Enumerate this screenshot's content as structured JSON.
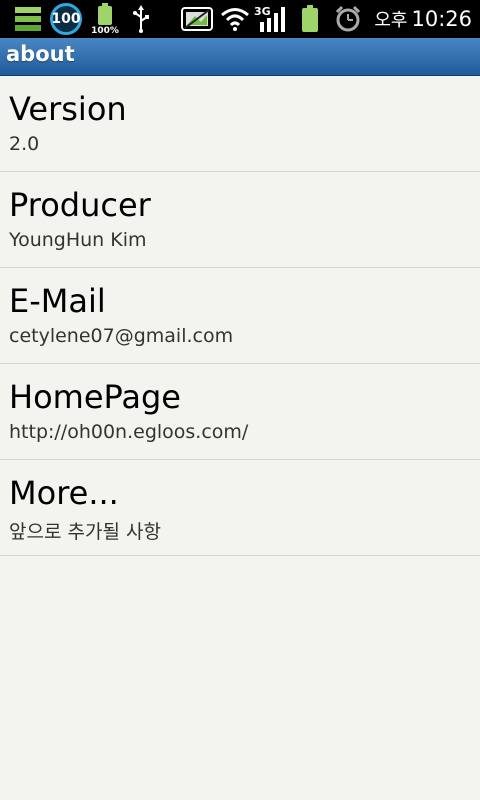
{
  "status_bar": {
    "badge_number": "100",
    "small_battery_percent": "100%",
    "network_type": "3G",
    "time_period": "오후",
    "time": "10:26",
    "icons": [
      "stack-icon",
      "badge-icon",
      "battery-small-icon",
      "usb-icon",
      "gallery-icon",
      "wifi-icon",
      "signal-icon",
      "battery-icon",
      "alarm-icon"
    ]
  },
  "title_bar": {
    "title": "about",
    "bg_color": "#2a6aab"
  },
  "list": {
    "items": [
      {
        "title": "Version",
        "subtitle": "2.0"
      },
      {
        "title": "Producer",
        "subtitle": "YoungHun Kim"
      },
      {
        "title": "E-Mail",
        "subtitle": "cetylene07@gmail.com"
      },
      {
        "title": "HomePage",
        "subtitle": "http://oh00n.egloos.com/"
      },
      {
        "title": "More...",
        "subtitle": "앞으로 추가될 사항"
      }
    ]
  }
}
